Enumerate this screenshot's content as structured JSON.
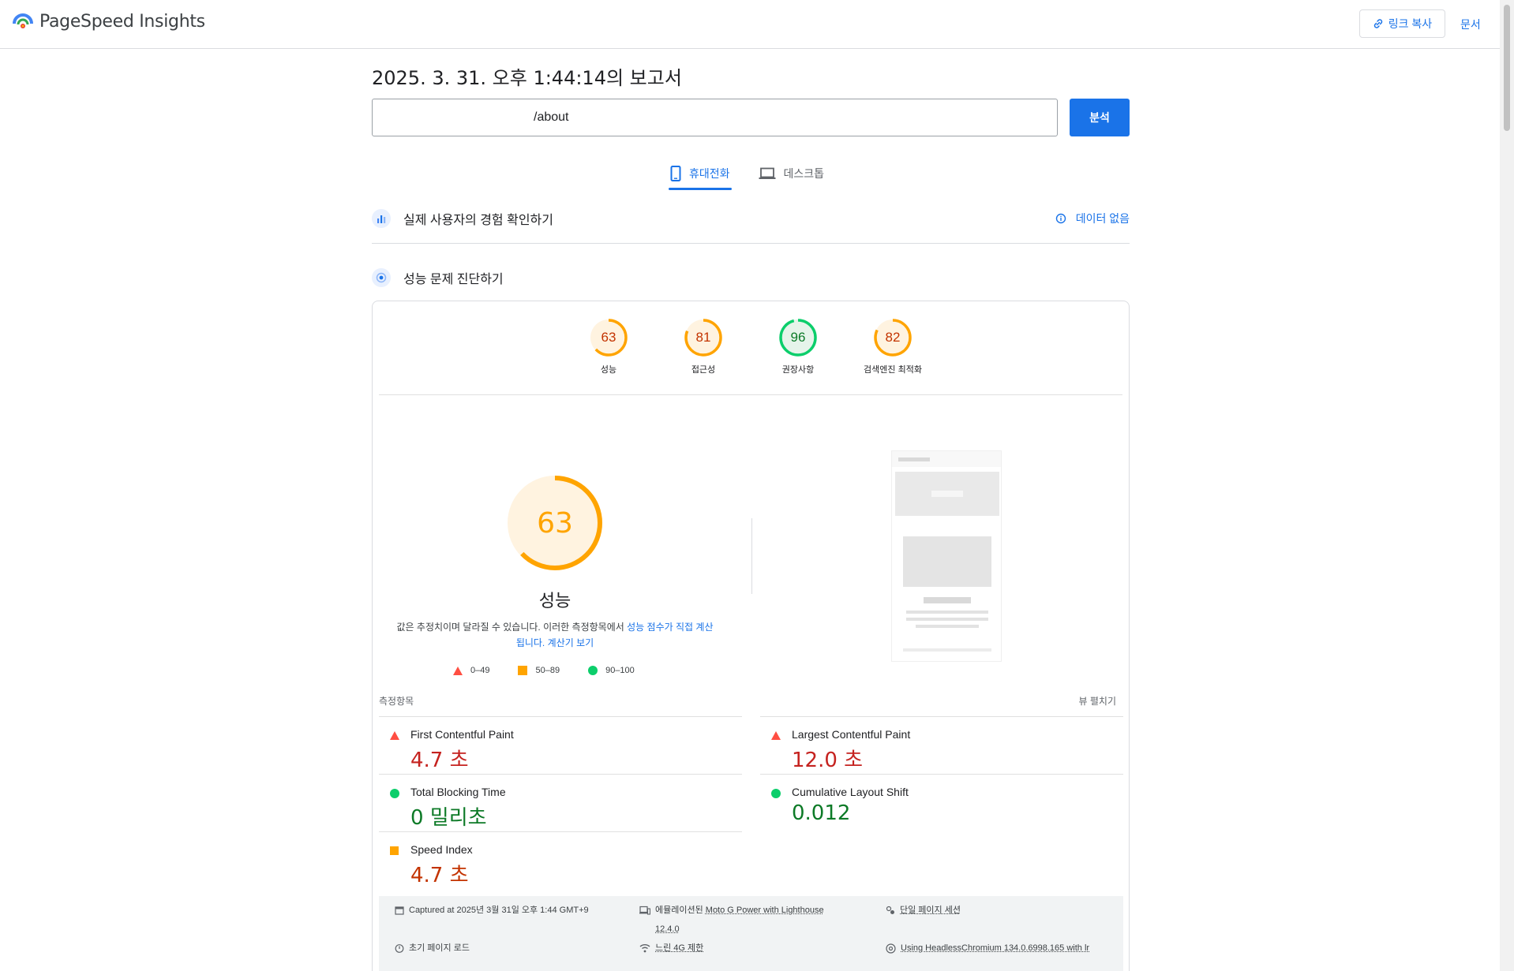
{
  "header": {
    "app_name": "PageSpeed Insights",
    "copy_link_label": "링크 복사",
    "docs_label": "문서",
    "colors": {
      "primary": "#1a73e8",
      "fail": "#ff4e42",
      "average": "#ffa400",
      "pass": "#0cce6b"
    }
  },
  "report": {
    "title": "2025. 3. 31. 오후 1:44:14의 보고서",
    "url_value": "/about",
    "analyze_label": "분석"
  },
  "tabs": [
    {
      "label": "휴대전화",
      "active": true,
      "icon": "phone-icon"
    },
    {
      "label": "데스크톱",
      "active": false,
      "icon": "laptop-icon"
    }
  ],
  "field_section": {
    "title": "실제 사용자의 경험 확인하기",
    "no_data_label": "데이터 없음",
    "icon": "users-chart-icon"
  },
  "lab_section": {
    "title": "성능 문제 진단하기",
    "icon": "diagnose-icon"
  },
  "scores": [
    {
      "value": "63",
      "label": "성능",
      "status": "average"
    },
    {
      "value": "81",
      "label": "접근성",
      "status": "average"
    },
    {
      "value": "96",
      "label": "권장사항",
      "status": "pass"
    },
    {
      "value": "82",
      "label": "검색엔진 최적화",
      "status": "average"
    }
  ],
  "performance": {
    "score": "63",
    "title": "성능",
    "desc_prefix": "값은 추정치이며 달라질 수 있습니다. 이러한 측정항목에서 ",
    "desc_link1": "성능 점수가 직접 계산됩니다.",
    "desc_link2": "계산기 보기",
    "legend": [
      "0–49",
      "50–89",
      "90–100"
    ]
  },
  "metrics_section": {
    "title": "측정항목",
    "expand_label": "뷰 펼치기"
  },
  "metrics": [
    {
      "name": "First Contentful Paint",
      "value": "4.7 초",
      "status": "fail"
    },
    {
      "name": "Largest Contentful Paint",
      "value": "12.0 초",
      "status": "fail"
    },
    {
      "name": "Total Blocking Time",
      "value": "0 밀리초",
      "status": "pass"
    },
    {
      "name": "Cumulative Layout Shift",
      "value": "0.012",
      "status": "pass"
    },
    {
      "name": "Speed Index",
      "value": "4.7 초",
      "status": "average"
    }
  ],
  "environment": {
    "captured": "Captured at 2025년 3월 31일 오후 1:44 GMT+9",
    "device_prefix": "에뮬레이션된 ",
    "device": "Moto G Power with Lighthouse",
    "device_version": "12.4.0",
    "session": "단일 페이지 세션",
    "load": "초기 페이지 로드",
    "throttle": "느린 4G 제한",
    "browser": "Using HeadlessChromium 134.0.6998.165 with lr"
  }
}
